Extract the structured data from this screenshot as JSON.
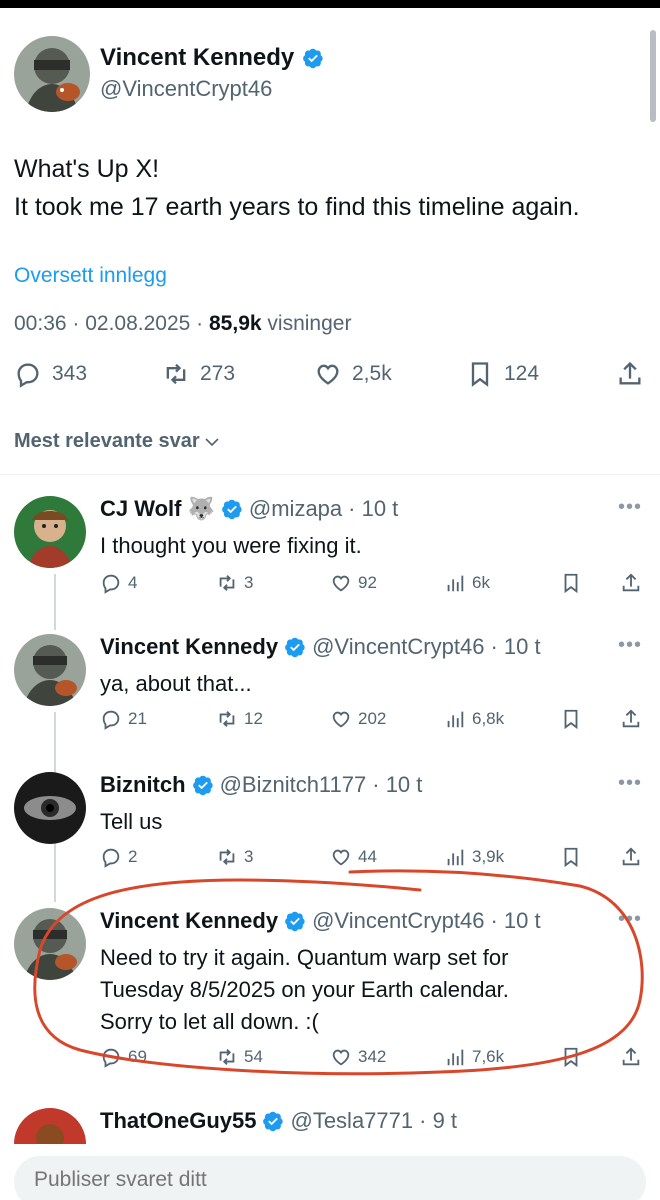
{
  "tweet": {
    "author_name": "Vincent Kennedy",
    "author_handle": "@VincentCrypt46",
    "text_line1": "What's Up X!",
    "text_line2": "It took me 17 earth years to find this timeline again.",
    "translate_label": "Oversett innlegg",
    "time": "00:36 · 02.08.2025 ·",
    "views_count": "85,9k",
    "views_label": "visninger",
    "replies": "343",
    "reposts": "273",
    "likes": "2,5k",
    "bookmarks": "124"
  },
  "sort_label": "Mest relevante svar",
  "replies": [
    {
      "name": "CJ Wolf",
      "emoji": "🐺",
      "handle": "@mizapa",
      "time": "· 10 t",
      "text": "I thought you were fixing it.",
      "replies": "4",
      "reposts": "3",
      "likes": "92",
      "views": "6k"
    },
    {
      "name": "Vincent Kennedy",
      "handle": "@VincentCrypt46",
      "time": "· 10 t",
      "text": "ya, about that...",
      "replies": "21",
      "reposts": "12",
      "likes": "202",
      "views": "6,8k"
    },
    {
      "name": "Biznitch",
      "handle": "@Biznitch1177",
      "time": "· 10 t",
      "text": "Tell us",
      "replies": "2",
      "reposts": "3",
      "likes": "44",
      "views": "3,9k"
    },
    {
      "name": "Vincent Kennedy",
      "handle": "@VincentCrypt46",
      "time": "· 10 t",
      "text_line1": "Need to try it again. Quantum warp set for",
      "text_line2": "Tuesday 8/5/2025 on your Earth calendar.",
      "text_line3": "Sorry to let all down. :(",
      "replies": "69",
      "reposts": "54",
      "likes": "342",
      "views": "7,6k"
    },
    {
      "name": "ThatOneGuy55",
      "handle": "@Tesla7771",
      "time": "· 9 t"
    }
  ],
  "compose": {
    "placeholder": "Publiser svaret ditt"
  },
  "colors": {
    "accent": "#1d9bf0",
    "muted": "#536471",
    "annotation": "#d9472b"
  },
  "icons": [
    "verified-badge-icon",
    "reply-icon",
    "repost-icon",
    "like-icon",
    "bookmark-icon",
    "share-icon",
    "views-icon",
    "more-icon",
    "chevron-down-icon"
  ]
}
